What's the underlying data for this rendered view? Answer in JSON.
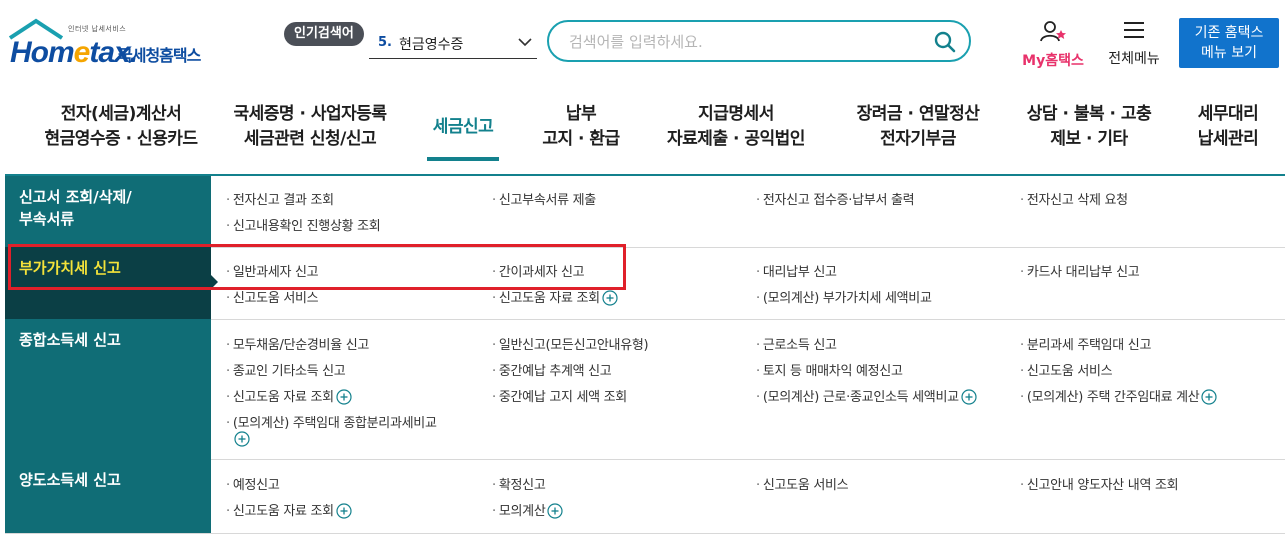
{
  "header": {
    "logo_small": "인터넷 납세서비스",
    "logo_brand_a": "Hom",
    "logo_brand_e": "e",
    "logo_brand_b": "tax.",
    "logo_kor": "국세청홈택스",
    "popular_tag": "인기검색어",
    "popular_num": "5.",
    "popular_text": "현금영수증",
    "search_placeholder": "검색어를 입력하세요.",
    "my_label": "My홈택스",
    "all_menu_label": "전체메뉴",
    "old_menu_line1": "기존 홈택스",
    "old_menu_line2": "메뉴 보기"
  },
  "gnb": [
    {
      "l1": "전자(세금)계산서",
      "l2": "현금영수증 · 신용카드"
    },
    {
      "l1": "국세증명 · 사업자등록",
      "l2": "세금관련 신청/신고"
    },
    {
      "l1": "세금신고",
      "l2": ""
    },
    {
      "l1": "납부",
      "l2": "고지 · 환급"
    },
    {
      "l1": "지급명세서",
      "l2": "자료제출 · 공익법인"
    },
    {
      "l1": "장려금 · 연말정산",
      "l2": "전자기부금"
    },
    {
      "l1": "상담 · 불복 · 고충",
      "l2": "제보 · 기타"
    },
    {
      "l1": "세무대리",
      "l2": "납세관리"
    }
  ],
  "rows": [
    {
      "cat": "신고서 조회/삭제/\n부속서류",
      "links": [
        "전자신고 결과 조회",
        "신고부속서류 제출",
        "전자신고 접수증·납부서 출력",
        "전자신고 삭제 요청",
        "신고내용확인 진행상황 조회"
      ]
    },
    {
      "cat": "부가가치세 신고",
      "links": [
        "일반과세자 신고",
        "간이과세자 신고",
        "대리납부 신고",
        "카드사 대리납부 신고",
        "신고도움 서비스",
        "신고도움 자료 조회",
        "(모의계산) 부가가치세 세액비교"
      ]
    },
    {
      "cat": "종합소득세 신고",
      "links": [
        "모두채움/단순경비율 신고",
        "일반신고(모든신고안내유형)",
        "근로소득 신고",
        "분리과세 주택임대 신고",
        "종교인 기타소득 신고",
        "중간예납 추계액 신고",
        "토지 등 매매차익 예정신고",
        "신고도움 서비스",
        "신고도움 자료 조회",
        "중간예납 고지 세액 조회",
        "(모의계산) 근로·종교인소득 세액비교",
        "(모의계산) 주택 간주임대료 계산",
        "(모의계산) 주택임대 종합분리과세비교"
      ]
    },
    {
      "cat": "양도소득세 신고",
      "links": [
        "예정신고",
        "확정신고",
        "신고도움 서비스",
        "신고안내 양도자산 내역 조회",
        "신고도움 자료 조회",
        "모의계산"
      ]
    }
  ],
  "colors": {
    "accent": "#13818d",
    "brand": "#0e4da1",
    "highlight": "#e0202a",
    "my": "#e8326b"
  }
}
